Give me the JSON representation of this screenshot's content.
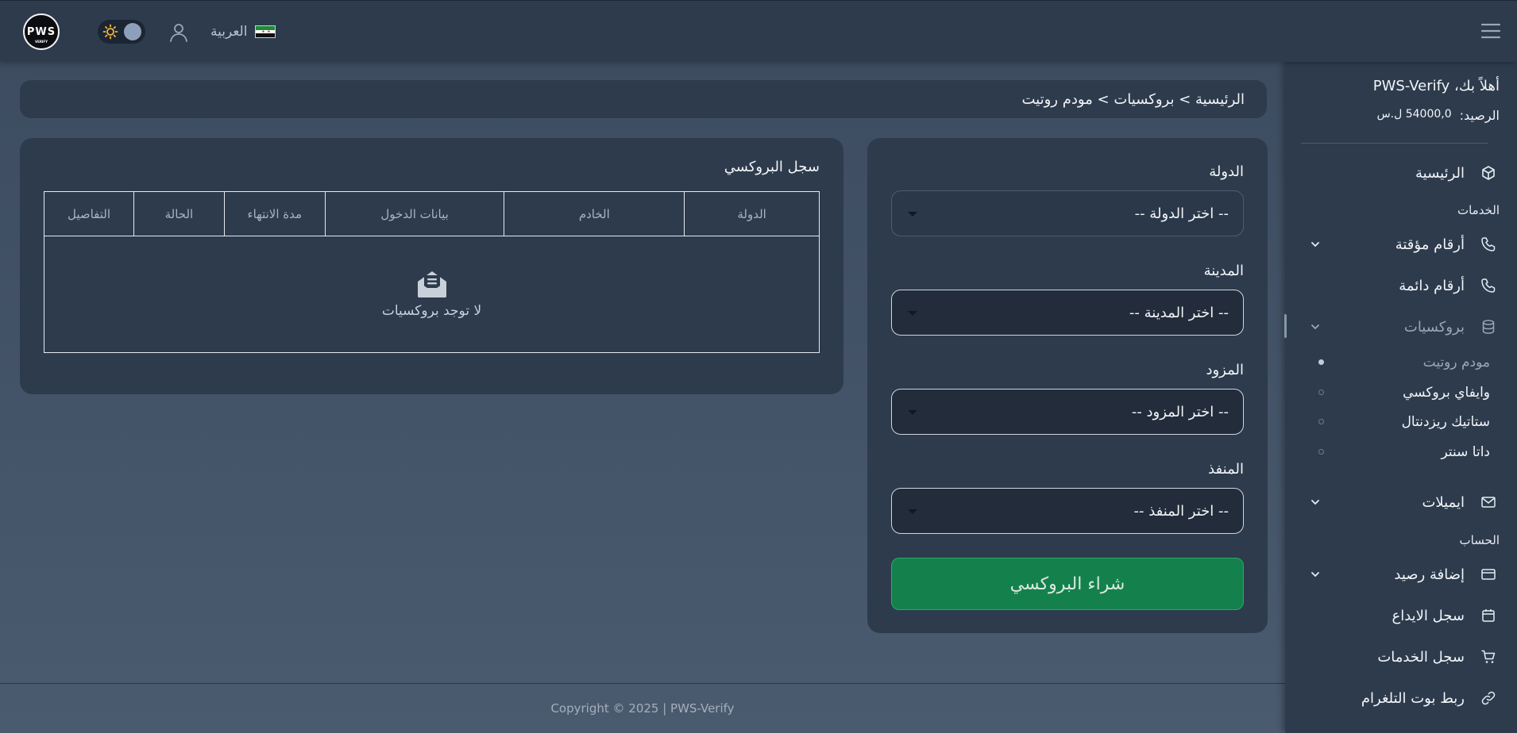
{
  "header": {
    "logo_text": "PWS",
    "logo_sub": "VERIFY",
    "language_label": "العربية"
  },
  "sidebar": {
    "welcome": "أهلاً بك، PWS-Verify",
    "balance_label": "الرصيد:",
    "balance_value": "54000,0 ل.س",
    "home": "الرئيسية",
    "services_label": "الخدمات",
    "temp_numbers": "أرقام مؤقتة",
    "perm_numbers": "أرقام دائمة",
    "proxies": "بروكسيات",
    "proxy_sub": [
      "مودم روتيت",
      "وايفاي بروكسي",
      "ستاتيك ريزدنتال",
      "داتا سنتر"
    ],
    "emails": "ايميلات",
    "account_label": "الحساب",
    "add_balance": "إضافة رصيد",
    "deposit_log": "سجل الايداع",
    "services_log": "سجل الخدمات",
    "telegram_bot": "ربط بوت التلغرام"
  },
  "breadcrumb": "الرئيسية > بروكسيات > مودم روتيت",
  "form": {
    "country_label": "الدولة",
    "country_placeholder": "-- اختر الدولة --",
    "city_label": "المدينة",
    "city_placeholder": "-- اختر المدينة --",
    "provider_label": "المزود",
    "provider_placeholder": "-- اختر المزود --",
    "port_label": "المنفذ",
    "port_placeholder": "-- اختر المنفذ --",
    "buy_button": "شراء البروكسي"
  },
  "log": {
    "title": "سجل البروكسي",
    "columns": [
      "الدولة",
      "الخادم",
      "بيانات الدخول",
      "مدة الانتهاء",
      "الحالة",
      "التفاصيل"
    ],
    "empty_text": "لا توجد بروكسيات"
  },
  "footer": "Copyright © 2025 | PWS-Verify",
  "colors": {
    "background": "#4a5a6f",
    "panel": "#2d3b4d",
    "accent_green": "#14814d"
  }
}
